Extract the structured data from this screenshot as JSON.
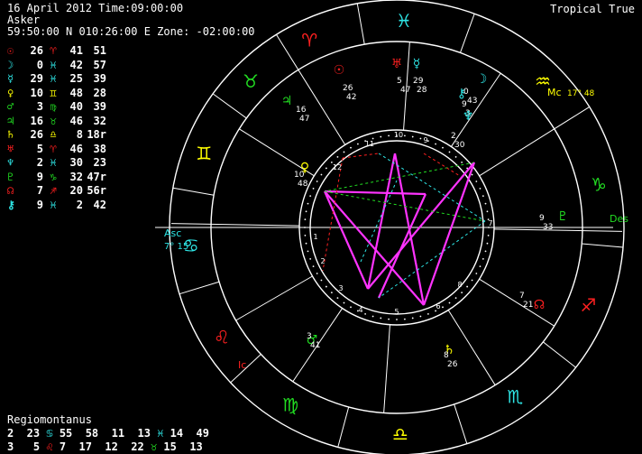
{
  "header": {
    "line1": "16 April 2012 Time:09:00:00",
    "line2": "Asker",
    "line3": "59:50:00 N 010:26:00 E Zone: -02:00:00",
    "system": "Tropical True"
  },
  "colors": {
    "red": "#ff2020",
    "cyan": "#2ee6e6",
    "green": "#22dd22",
    "yellow": "#ffff00",
    "magenta": "#ff33ff",
    "white": "#ffffff",
    "blue": "#4488ff"
  },
  "positions": [
    {
      "glyph": "☉",
      "deg": "26",
      "sign": "♈",
      "min": "41",
      "sec": "51",
      "color": "#ff2020"
    },
    {
      "glyph": "☽",
      "deg": "0",
      "sign": "♓",
      "min": "42",
      "sec": "57",
      "color": "#2ee6e6"
    },
    {
      "glyph": "☿",
      "deg": "29",
      "sign": "♓",
      "min": "25",
      "sec": "39",
      "color": "#2ee6e6"
    },
    {
      "glyph": "♀",
      "deg": "10",
      "sign": "♊",
      "min": "48",
      "sec": "28",
      "color": "#ffff00"
    },
    {
      "glyph": "♂",
      "deg": "3",
      "sign": "♍",
      "min": "40",
      "sec": "39",
      "color": "#22dd22"
    },
    {
      "glyph": "♃",
      "deg": "16",
      "sign": "♉",
      "min": "46",
      "sec": "32",
      "color": "#22dd22"
    },
    {
      "glyph": "♄",
      "deg": "26",
      "sign": "♎",
      "min": "8",
      "sec": "18r",
      "color": "#ffff00"
    },
    {
      "glyph": "♅",
      "deg": "5",
      "sign": "♈",
      "min": "46",
      "sec": "38",
      "color": "#ff2020"
    },
    {
      "glyph": "♆",
      "deg": "2",
      "sign": "♓",
      "min": "30",
      "sec": "23",
      "color": "#2ee6e6"
    },
    {
      "glyph": "♇",
      "deg": "9",
      "sign": "♑",
      "min": "32",
      "sec": "47r",
      "color": "#22dd22"
    },
    {
      "glyph": "☊",
      "deg": "7",
      "sign": "♐",
      "min": "20",
      "sec": "56r",
      "color": "#ff2020"
    },
    {
      "glyph": "⚷",
      "deg": "9",
      "sign": "♓",
      "min": "2",
      "sec": "42",
      "color": "#2ee6e6"
    }
  ],
  "houses": {
    "title": "Regiomontanus",
    "row1": [
      {
        "text": "2  23",
        "color": "#ffffff"
      },
      {
        "text": "♋",
        "color": "#2ee6e6"
      },
      {
        "text": "55  58  11  13",
        "color": "#ffffff"
      },
      {
        "text": "♓",
        "color": "#2ee6e6"
      },
      {
        "text": "14  49",
        "color": "#ffffff"
      }
    ],
    "row2": [
      {
        "text": "3   5",
        "color": "#ffffff"
      },
      {
        "text": "♌",
        "color": "#ff2020"
      },
      {
        "text": "7  17  12  22",
        "color": "#ffffff"
      },
      {
        "text": "♉",
        "color": "#22dd22"
      },
      {
        "text": "15  13",
        "color": "#ffffff"
      }
    ]
  },
  "wheel": {
    "zodiac": [
      {
        "glyph": "♈",
        "color": "#ff2020",
        "angle": 115
      },
      {
        "glyph": "♓",
        "color": "#2ee6e6",
        "angle": 88
      },
      {
        "glyph": "♒",
        "color": "#ffff00",
        "angle": 45
      },
      {
        "glyph": "♑",
        "color": "#22dd22",
        "angle": 12
      },
      {
        "glyph": "♐",
        "color": "#ff2020",
        "angle": -22
      },
      {
        "glyph": "♏",
        "color": "#2ee6e6",
        "angle": -55
      },
      {
        "glyph": "♎",
        "color": "#ffff00",
        "angle": -89
      },
      {
        "glyph": "♍",
        "color": "#22dd22",
        "angle": -121
      },
      {
        "glyph": "♌",
        "color": "#ff2020",
        "angle": -148
      },
      {
        "glyph": "♋",
        "color": "#2ee6e6",
        "angle": -175
      },
      {
        "glyph": "♊",
        "color": "#ffff00",
        "angle": 159
      },
      {
        "glyph": "♉",
        "color": "#22dd22",
        "angle": 135
      }
    ],
    "angles": {
      "asc": "Asc",
      "asc_deg": "7° 15",
      "mc": "Mc",
      "mc_deg": "17° 48",
      "des": "Des",
      "ic": "Ic"
    },
    "planets": [
      {
        "glyph": "☉",
        "color": "#ff2020",
        "deg": "26",
        "min": "42"
      },
      {
        "glyph": "♅",
        "color": "#ff2020",
        "deg": "5",
        "min": "47"
      },
      {
        "glyph": "☿",
        "color": "#2ee6e6",
        "deg": "29",
        "min": "28"
      },
      {
        "glyph": "☽",
        "color": "#2ee6e6",
        "deg": "0",
        "min": "43"
      },
      {
        "glyph": "⚷",
        "color": "#2ee6e6",
        "deg": "9",
        "min": "3"
      },
      {
        "glyph": "♆",
        "color": "#2ee6e6",
        "deg": "2",
        "min": "30"
      },
      {
        "glyph": "♇",
        "color": "#22dd22",
        "deg": "9",
        "min": "33"
      },
      {
        "glyph": "☊",
        "color": "#ff2020",
        "deg": "7",
        "min": "21"
      },
      {
        "glyph": "♄",
        "color": "#ffff00",
        "deg": "8",
        "min": "26"
      },
      {
        "glyph": "♂",
        "color": "#22dd22",
        "deg": "3",
        "min": "41"
      },
      {
        "glyph": "♀",
        "color": "#ffff00",
        "deg": "10",
        "min": "48"
      },
      {
        "glyph": "♃",
        "color": "#22dd22",
        "deg": "16",
        "min": "47"
      }
    ],
    "house_numbers": [
      "1",
      "2",
      "3",
      "4",
      "5",
      "6",
      "7",
      "8",
      "9",
      "10",
      "11",
      "12"
    ]
  }
}
